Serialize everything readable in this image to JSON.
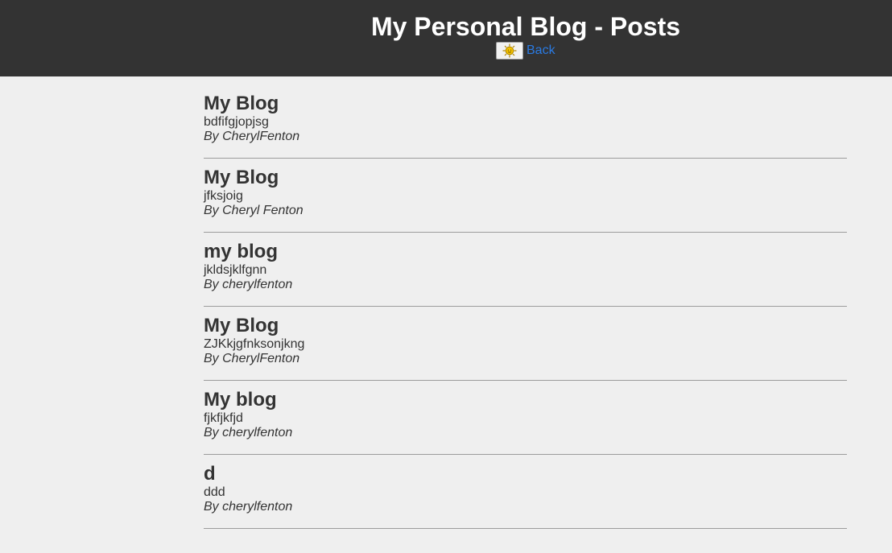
{
  "header": {
    "title": "My Personal Blog - Posts",
    "theme_icon": "sun-icon",
    "back_label": "Back"
  },
  "posts": [
    {
      "title": "My Blog",
      "body": "bdfifgjopjsg",
      "author": "By CherylFenton"
    },
    {
      "title": "My Blog",
      "body": "jfksjoig",
      "author": "By Cheryl Fenton"
    },
    {
      "title": "my blog",
      "body": "jkldsjklfgnn",
      "author": "By cherylfenton"
    },
    {
      "title": "My Blog",
      "body": "ZJKkjgfnksonjkng",
      "author": "By CherylFenton"
    },
    {
      "title": "My blog",
      "body": "fjkfjkfjd",
      "author": "By cherylfenton"
    },
    {
      "title": "d",
      "body": "ddd",
      "author": "By cherylfenton"
    }
  ],
  "colors": {
    "header_bg": "#333333",
    "page_bg": "#efefef",
    "link": "#2a7ae2",
    "text": "#333333",
    "sun": "#f5c400"
  }
}
